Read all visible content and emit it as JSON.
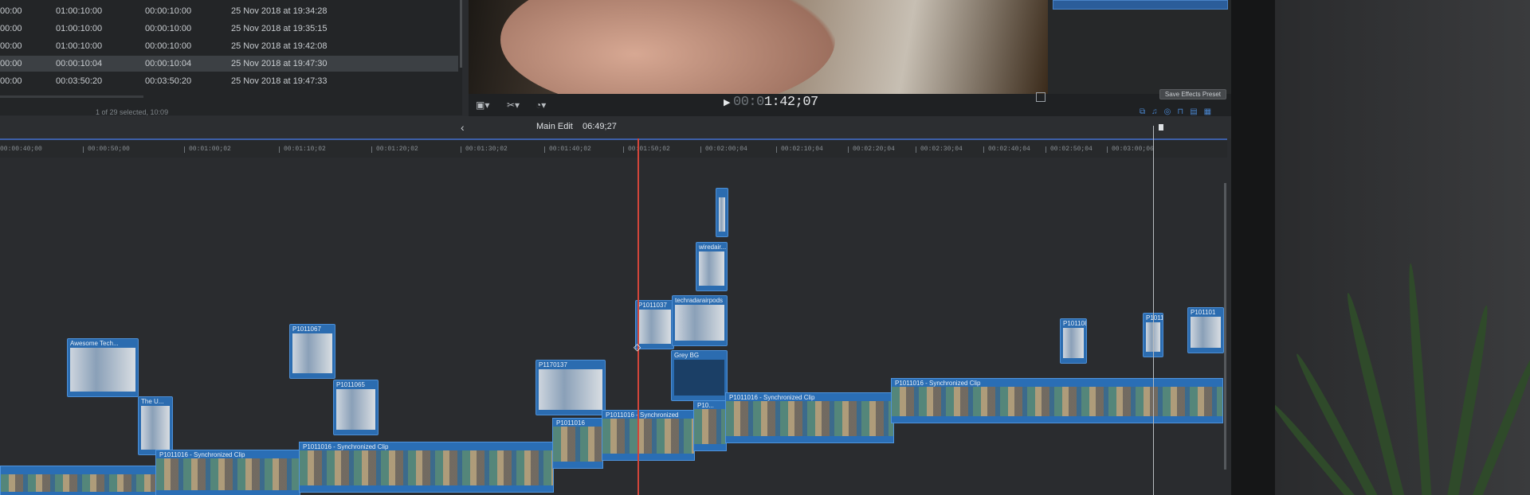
{
  "browser": {
    "rows": [
      {
        "start": "00:00",
        "end": "01:00:10:00",
        "duration": "00:00:10:00",
        "date": "25 Nov 2018 at 19:34:28",
        "selected": false
      },
      {
        "start": "00:00",
        "end": "01:00:10:00",
        "duration": "00:00:10:00",
        "date": "25 Nov 2018 at 19:35:15",
        "selected": false
      },
      {
        "start": "00:00",
        "end": "01:00:10:00",
        "duration": "00:00:10:00",
        "date": "25 Nov 2018 at 19:42:08",
        "selected": false
      },
      {
        "start": "00:00",
        "end": "00:00:10:04",
        "duration": "00:00:10:04",
        "date": "25 Nov 2018 at 19:47:30",
        "selected": true
      },
      {
        "start": "00:00",
        "end": "00:03:50:20",
        "duration": "00:03:50:20",
        "date": "25 Nov 2018 at 19:47:33",
        "selected": false
      }
    ],
    "status": "1 of 29 selected, 10:09"
  },
  "viewer": {
    "timecode_dim": "00:0",
    "timecode": "1:42;07",
    "play_icon": "play-icon",
    "save_effects_preset": "Save Effects Preset"
  },
  "timeline_header": {
    "back": "‹",
    "project": "Main Edit",
    "duration": "06:49;27"
  },
  "ruler": {
    "ticks": [
      "00:00:40;00",
      "00:00:50;00",
      "00:01:00;02",
      "00:01:10;02",
      "00:01:20;02",
      "00:01:30;02",
      "00:01:40;02",
      "00:01:50;02",
      "00:02:00;04",
      "00:02:10;04",
      "00:02:20;04",
      "00:02:30;04",
      "00:02:40;04",
      "00:02:50;04",
      "00:03:00;06"
    ]
  },
  "clips": {
    "awesome": "Awesome Tech...",
    "the": "The U...",
    "p1011067": "P1011067",
    "p1011065": "P1011065",
    "p1170137": "P1170137",
    "p1011037": "P1011037",
    "techradarairpods": "techradarairpods",
    "wiredairpods": "wiredair...",
    "grey_bg": "Grey BG",
    "p1011085": "P101108S",
    "p1011_small": "P1011",
    "p101101": "P101101"
  },
  "storyline": {
    "seg1": "P1011016 - Synchronized Clip",
    "seg2": "P1011016 - Synchronized Clip",
    "seg3": "P1011016",
    "seg4": "P1011016 - Synchronized",
    "seg5": "P10...",
    "seg6": "P1011016 - Synchronized Clip",
    "seg7": "P1011016 - Synchronized Clip"
  }
}
